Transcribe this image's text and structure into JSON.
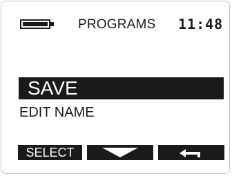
{
  "header": {
    "battery_icon": "battery-full-icon",
    "title": "PROGRAMS",
    "time": "11:48"
  },
  "menu": {
    "items": [
      {
        "label": "SAVE",
        "selected": true
      },
      {
        "label": "EDIT NAME",
        "selected": false
      }
    ]
  },
  "softkeys": {
    "left_label": "SELECT",
    "middle_icon": "chevron-down-icon",
    "right_icon": "back-arrow-icon"
  },
  "colors": {
    "foreground": "#1a1a1a",
    "background": "#ffffff"
  }
}
